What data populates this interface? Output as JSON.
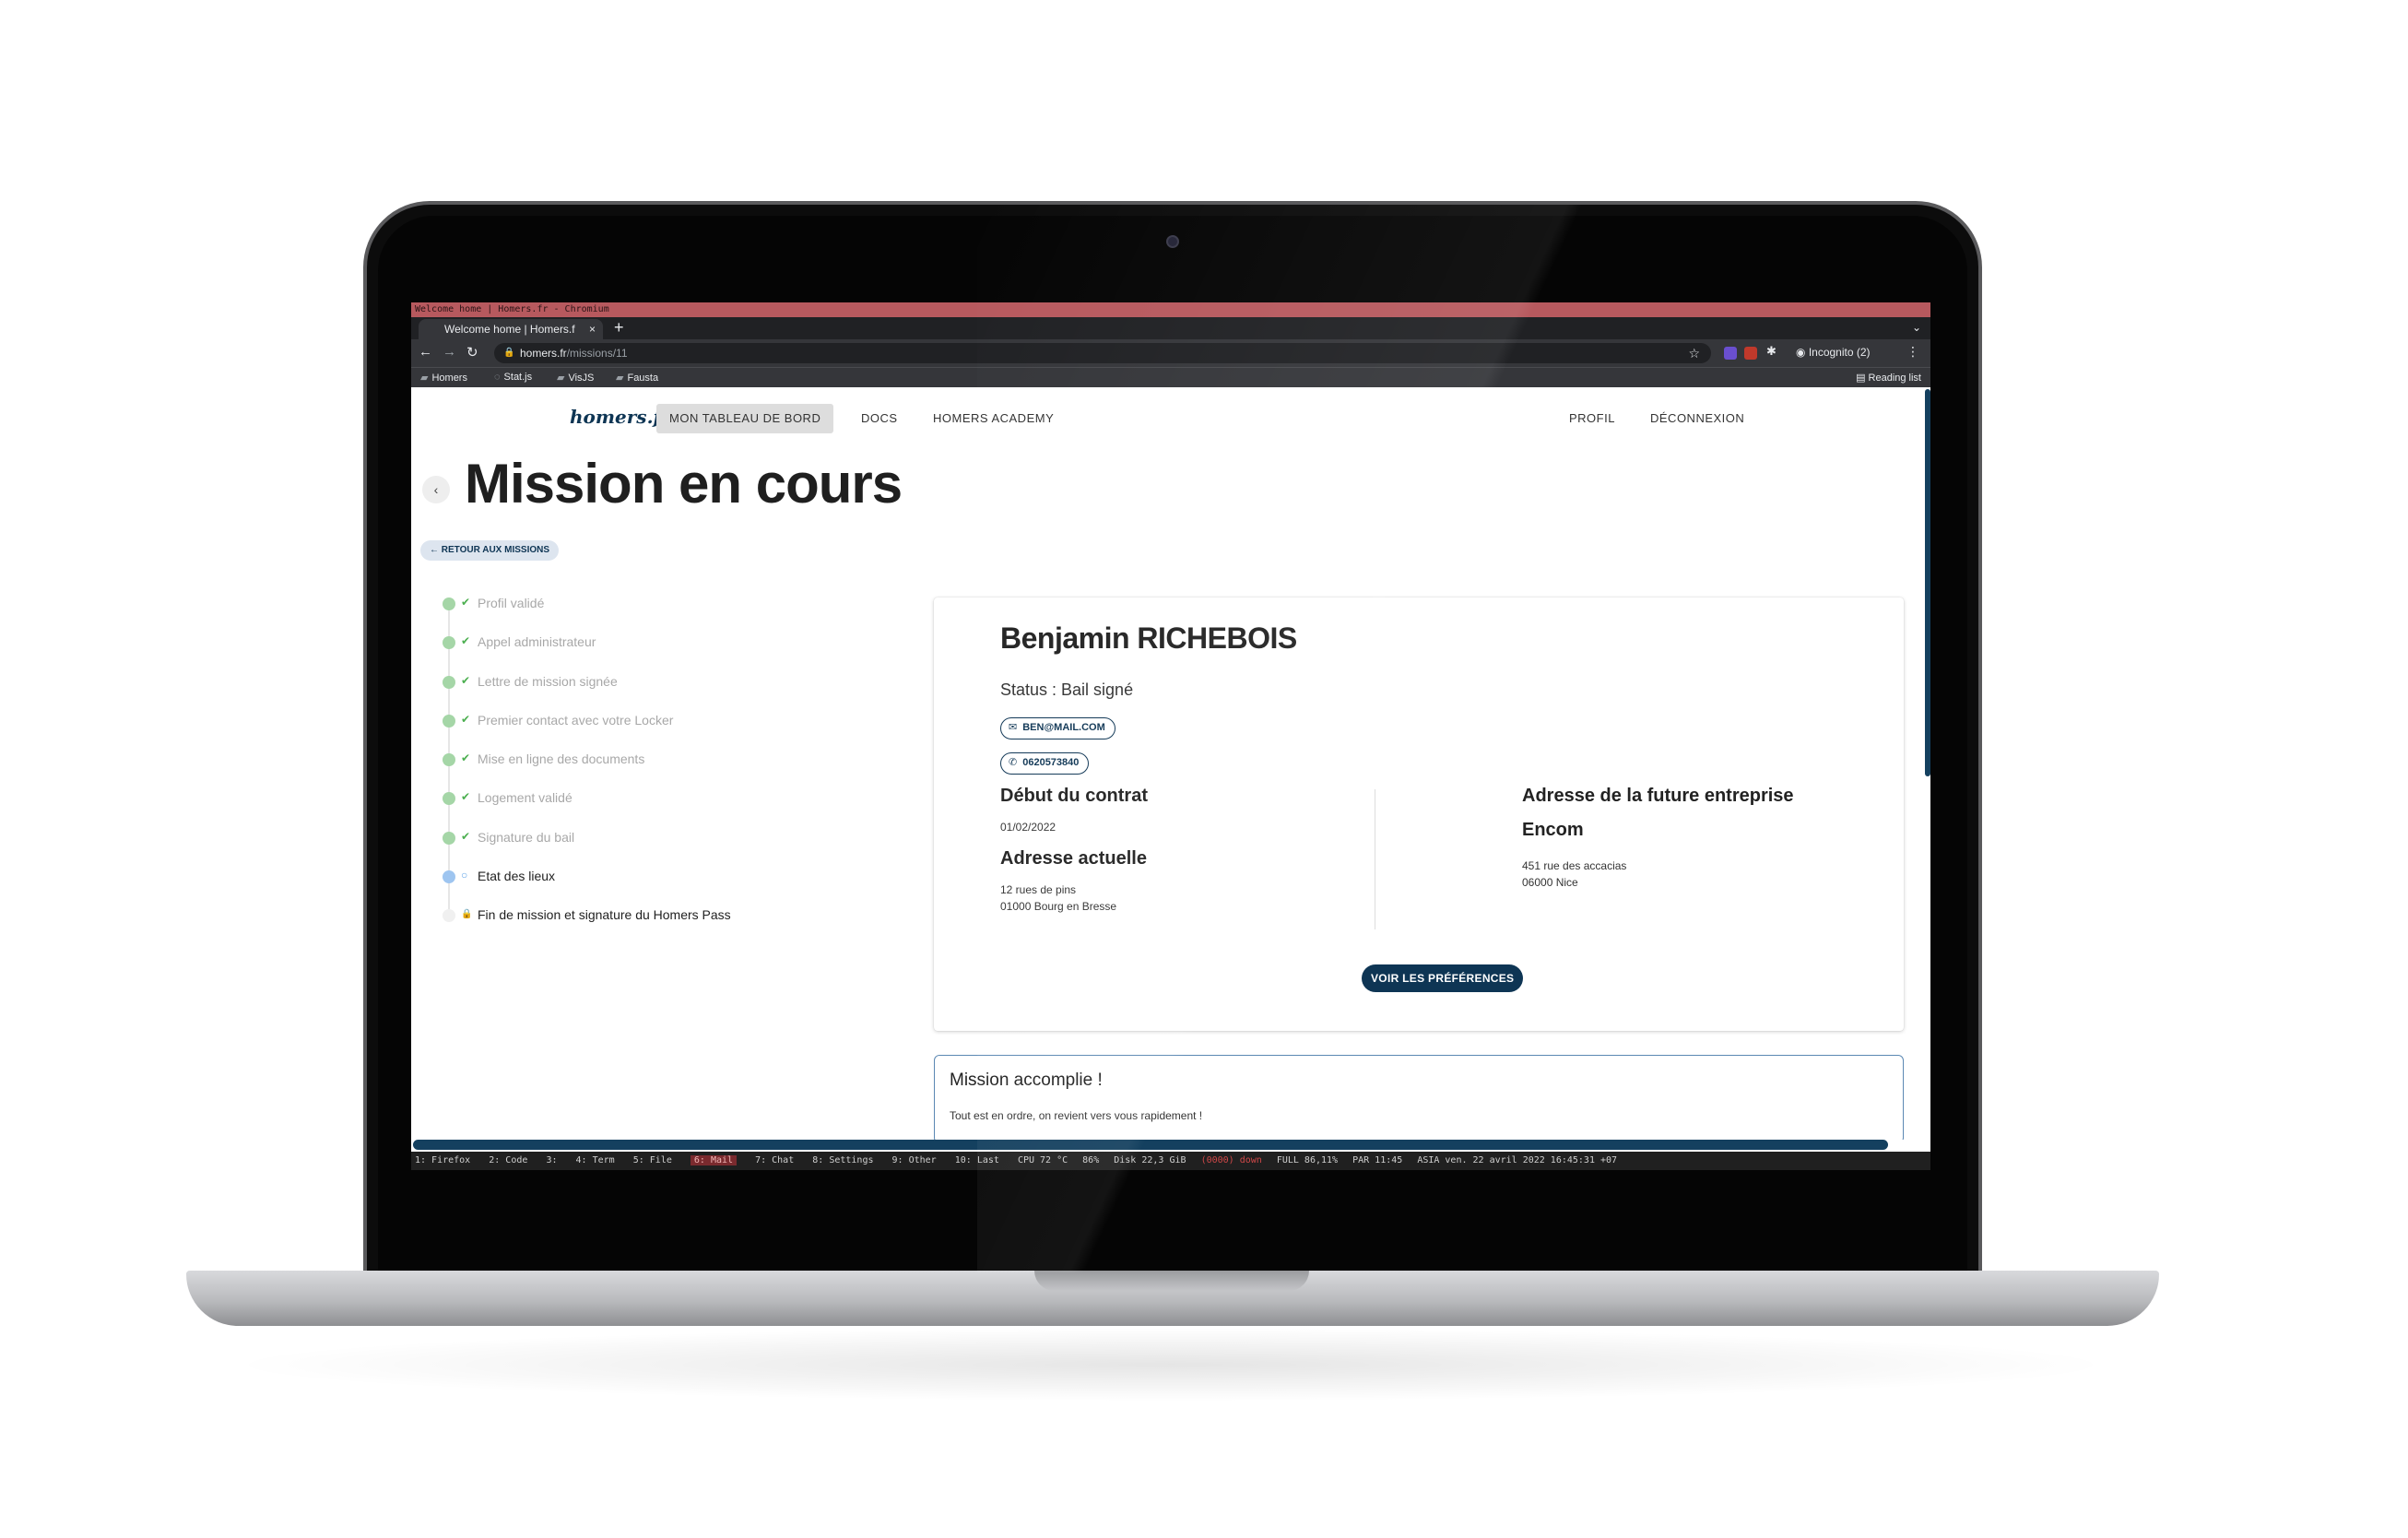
{
  "window": {
    "title": "Welcome home | Homers.fr - Chromium"
  },
  "browser": {
    "tab_title": "Welcome home | Homers.f",
    "tab_close": "×",
    "new_tab": "+",
    "url_host": "homers.fr",
    "url_path": "/missions/11",
    "profile_label": "Incognito (2)",
    "bookmarks": [
      "Homers",
      "Stat.js",
      "VisJS",
      "Fausta"
    ],
    "reading_list": "Reading list"
  },
  "nav": {
    "logo": "homers.fr",
    "items": [
      "MON TABLEAU DE BORD",
      "DOCS",
      "HOMERS ACADEMY"
    ],
    "right_items": [
      "PROFIL",
      "DÉCONNEXION"
    ]
  },
  "page": {
    "title": "Mission en cours",
    "back_label": "RETOUR AUX MISSIONS"
  },
  "steps": [
    {
      "label": "Profil validé",
      "state": "done",
      "mark": "✔"
    },
    {
      "label": "Appel administrateur",
      "state": "done",
      "mark": "✔"
    },
    {
      "label": "Lettre de mission signée",
      "state": "done",
      "mark": "✔"
    },
    {
      "label": "Premier contact avec votre Locker",
      "state": "done",
      "mark": "✔"
    },
    {
      "label": "Mise en ligne des documents",
      "state": "done",
      "mark": "✔"
    },
    {
      "label": "Logement validé",
      "state": "done",
      "mark": "✔"
    },
    {
      "label": "Signature du bail",
      "state": "done",
      "mark": "✔"
    },
    {
      "label": "Etat des lieux",
      "state": "current",
      "mark": "○"
    },
    {
      "label": "Fin de mission et signature du Homers Pass",
      "state": "todo",
      "mark": "🔒"
    }
  ],
  "card": {
    "name": "Benjamin RICHEBOIS",
    "status": "Status : Bail signé",
    "email": "BEN@MAIL.COM",
    "phone": "0620573840",
    "contract_start_label": "Début du contrat",
    "contract_start": "01/02/2022",
    "current_address_label": "Adresse actuelle",
    "current_address_line1": "12 rues de pins",
    "current_address_line2": "01000 Bourg en Bresse",
    "company_address_label": "Adresse de la future entreprise",
    "company_name": "Encom",
    "company_address_line1": "451 rue des accacias",
    "company_address_line2": "06000 Nice",
    "preferences_button": "VOIR LES PRÉFÉRENCES"
  },
  "alert": {
    "title": "Mission accomplie !",
    "text": "Tout est en ordre, on revient vers vous rapidement !"
  },
  "statusbar": {
    "workspaces": [
      "1: Firefox",
      "2: Code",
      "3:",
      "4: Term",
      "5: File",
      "6: Mail",
      "7: Chat",
      "8: Settings",
      "9: Other",
      "10: Last"
    ],
    "system": [
      "CPU 72 °C",
      "86%",
      "Disk 22,3 GiB",
      "(0000) down",
      "FULL 86,11%",
      "PAR 11:45",
      "ASIA ven. 22 avril 2022 16:45:31 +07"
    ]
  },
  "colors": {
    "brand": "#0e3554",
    "done": "#a5d6a7",
    "current": "#9ec5f0",
    "wm_bar": "#b7595e"
  },
  "icons": {
    "email": "mail-icon",
    "phone": "phone-icon",
    "back": "chevron-left-icon",
    "lock": "lock-icon"
  }
}
